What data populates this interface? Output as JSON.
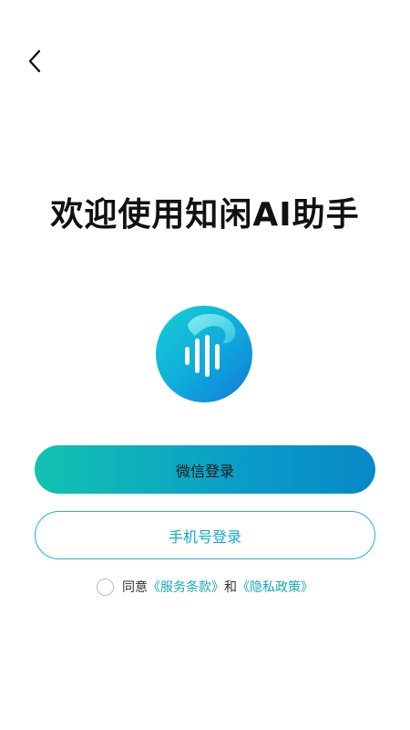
{
  "header": {
    "back_icon": "chevron-left-icon"
  },
  "title": "欢迎使用知闲AI助手",
  "logo": {
    "icon": "voice-wave-logo"
  },
  "buttons": {
    "wechat_login": "微信登录",
    "phone_login": "手机号登录"
  },
  "agreement": {
    "prefix": "同意",
    "terms": "《服务条款》",
    "conjunction": "和",
    "privacy": "《隐私政策》"
  },
  "colors": {
    "accent_start": "#13c2b0",
    "accent_end": "#0888c7",
    "link": "#17a9b5"
  }
}
